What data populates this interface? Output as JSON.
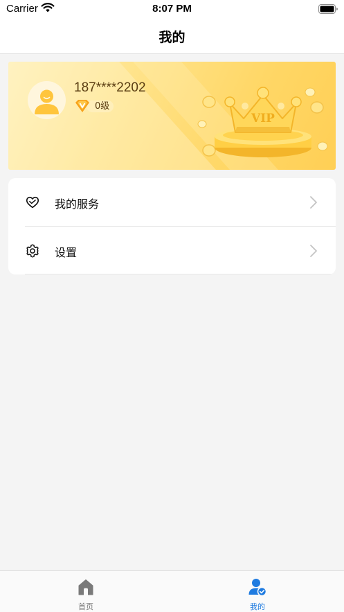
{
  "status_bar": {
    "carrier": "Carrier",
    "time": "8:07 PM"
  },
  "nav": {
    "title": "我的"
  },
  "profile": {
    "phone": "187****2202",
    "level": "0级",
    "vip_text": "VIP"
  },
  "menu": {
    "items": [
      {
        "label": "我的服务",
        "icon": "heart-icon"
      },
      {
        "label": "设置",
        "icon": "gear-icon"
      }
    ]
  },
  "tab_bar": {
    "tabs": [
      {
        "label": "首页",
        "icon": "home-icon",
        "active": false
      },
      {
        "label": "我的",
        "icon": "user-badge-icon",
        "active": true
      }
    ]
  },
  "colors": {
    "accent": "#1f7be0",
    "inactive_tab": "#777777",
    "gold_text": "#5a3d12",
    "banner_gold": "#ffd766"
  }
}
